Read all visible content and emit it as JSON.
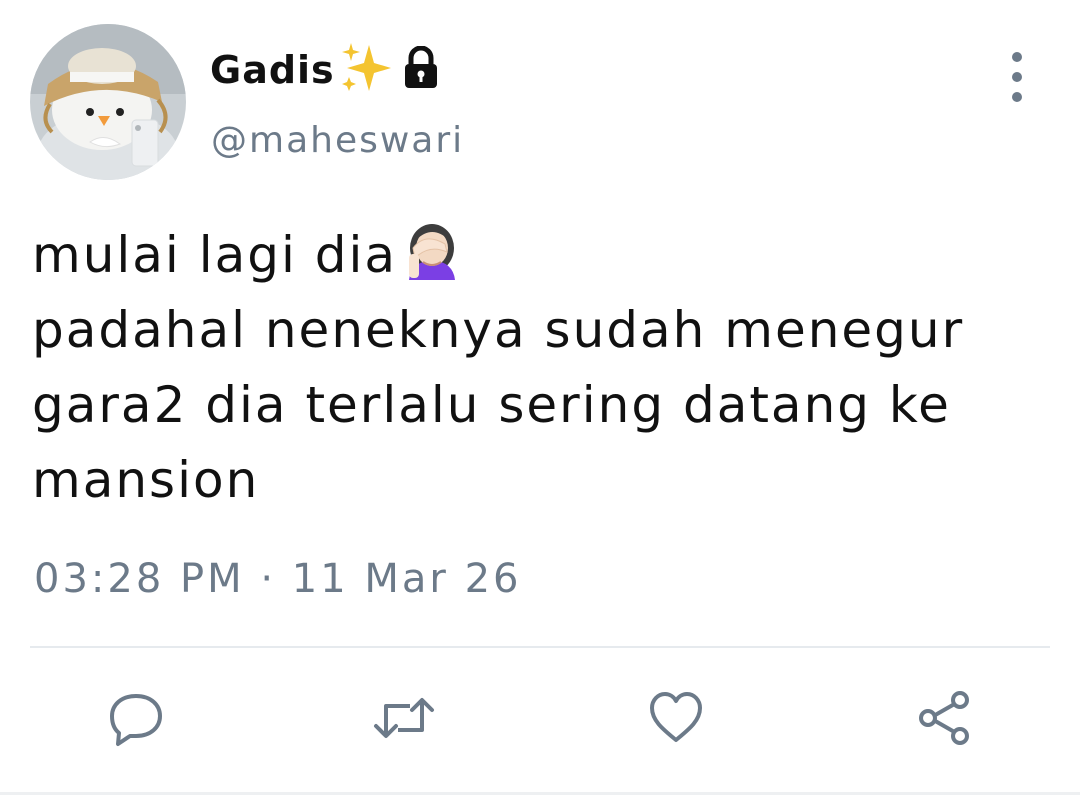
{
  "profile": {
    "display_name": "Gadis",
    "handle": "@maheswari",
    "name_icons": [
      "sparkles-icon",
      "lock-icon"
    ]
  },
  "tweet": {
    "lines": [
      "mulai lagi dia",
      "padahal neneknya sudah menegur",
      "gara2 dia terlalu sering datang ke",
      "mansion"
    ],
    "emoji": "woman-facepalming-icon",
    "timestamp": "03:28 PM · 11 Mar 26"
  },
  "actions": [
    "reply-icon",
    "retweet-icon",
    "like-icon",
    "share-icon"
  ],
  "colors": {
    "text": "#111111",
    "muted": "#6c7a89",
    "divider": "#e6eaee",
    "sparkle": "#f4c430"
  }
}
